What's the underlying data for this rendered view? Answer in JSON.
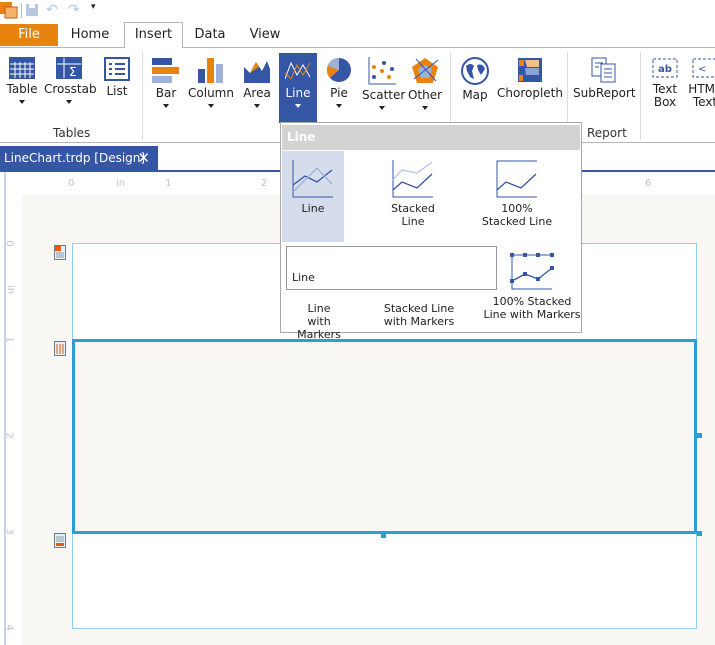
{
  "quick_access": {
    "icons": [
      "app-icon",
      "save-icon",
      "undo-icon",
      "redo-icon",
      "customize-icon"
    ]
  },
  "tabs": {
    "file": "File",
    "home": "Home",
    "insert": "Insert",
    "data": "Data",
    "view": "View"
  },
  "ribbon": {
    "buttons": {
      "table": "Table",
      "crosstab": "Crosstab",
      "list": "List",
      "bar": "Bar",
      "column": "Column",
      "area": "Area",
      "line": "Line",
      "pie": "Pie",
      "scatter": "Scatter",
      "other": "Other",
      "map": "Map",
      "choropleth": "Choropleth",
      "subreport": "SubReport",
      "textbox1": "Text",
      "textbox2": "Box",
      "html1": "HTML",
      "html2": "Text"
    },
    "groups": {
      "tables": "Tables",
      "report": "Report"
    }
  },
  "document_tab": {
    "title": "LineChart.trdp [Design]",
    "close": "✕"
  },
  "ruler": {
    "top": [
      "0",
      "in",
      "1",
      "2",
      "6"
    ],
    "left": [
      "0",
      "in",
      "1",
      "2",
      "3",
      "4"
    ]
  },
  "dropdown": {
    "header": "Line",
    "items": [
      {
        "l1": "Line",
        "l2": ""
      },
      {
        "l1": "Stacked",
        "l2": "Line"
      },
      {
        "l1": "100%",
        "l2": "Stacked Line"
      },
      {
        "l1": "Line",
        "l2": "with Markers"
      },
      {
        "l1": "Stacked Line",
        "l2": "with Markers"
      },
      {
        "l1": "100% Stacked",
        "l2": "Line with Markers"
      }
    ],
    "tooltip": "Line"
  },
  "colors": {
    "accent": "#3456a4",
    "orange": "#e8830f",
    "selection": "#2a9fd6",
    "section_border": "#8fd0ee"
  }
}
